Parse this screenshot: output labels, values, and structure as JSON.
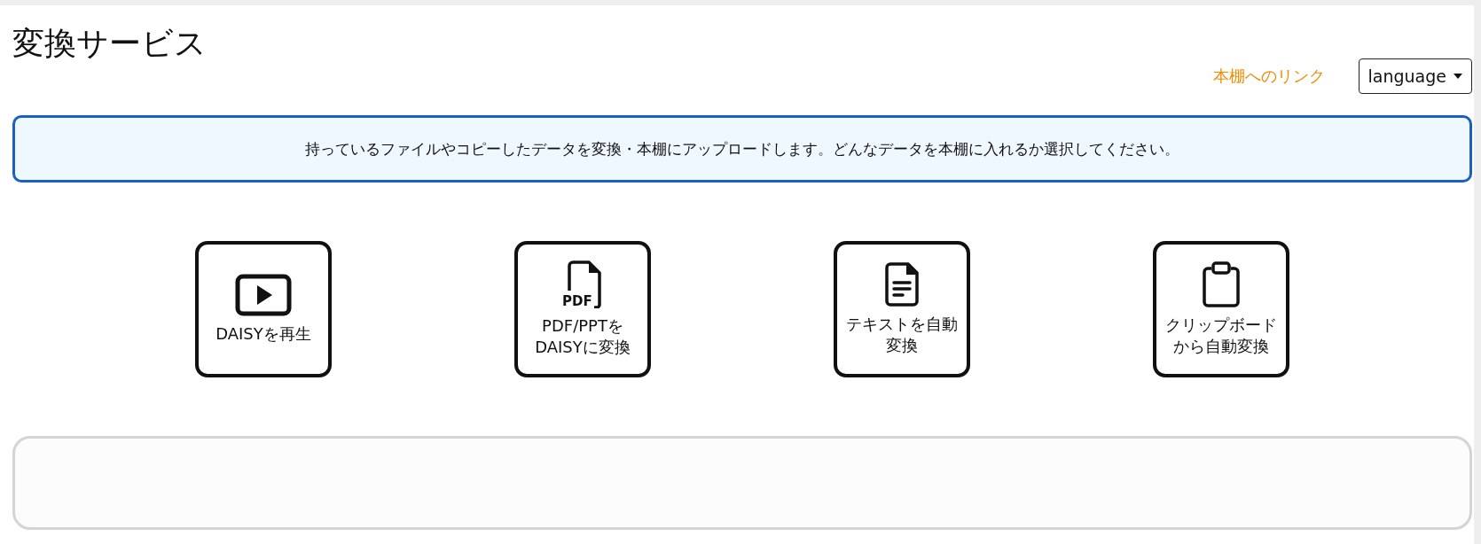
{
  "title": "変換サービス",
  "header": {
    "link": "本棚へのリンク",
    "language_select": "language"
  },
  "info": "持っているファイルやコピーしたデータを変換・本棚にアップロードします。どんなデータを本棚に入れるか選択してください。",
  "services": [
    {
      "kind": "play",
      "lines": [
        "DAISYを再生"
      ]
    },
    {
      "kind": "pdf",
      "icon_label": "PDF",
      "lines": [
        "PDF/PPTを",
        "DAISYに変換"
      ]
    },
    {
      "kind": "text",
      "lines": [
        "テキストを自動",
        "変換"
      ]
    },
    {
      "kind": "clipboard",
      "lines": [
        "クリップボード",
        "から自動変換"
      ]
    }
  ]
}
